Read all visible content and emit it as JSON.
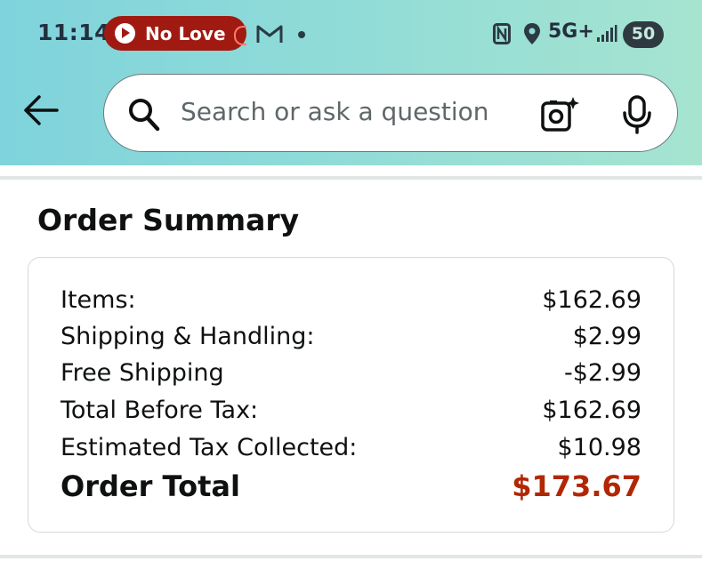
{
  "status_bar": {
    "time": "11:14",
    "media_title": "No Love",
    "network": "5G+",
    "battery": "50"
  },
  "search": {
    "placeholder": "Search or ask a question"
  },
  "summary": {
    "heading": "Order Summary",
    "rows": [
      {
        "label": "Items:",
        "value": "$162.69"
      },
      {
        "label": "Shipping & Handling:",
        "value": "$2.99"
      },
      {
        "label": "Free Shipping",
        "value": "-$2.99"
      },
      {
        "label": "Total Before Tax:",
        "value": "$162.69"
      },
      {
        "label": "Estimated Tax Collected:",
        "value": "$10.98"
      }
    ],
    "total_label": "Order Total",
    "total_value": "$173.67"
  },
  "colors": {
    "header_gradient_start": "#7fd3dc",
    "header_gradient_end": "#a6e4d0",
    "total_red": "#b12704",
    "media_pill": "#a11a12"
  }
}
